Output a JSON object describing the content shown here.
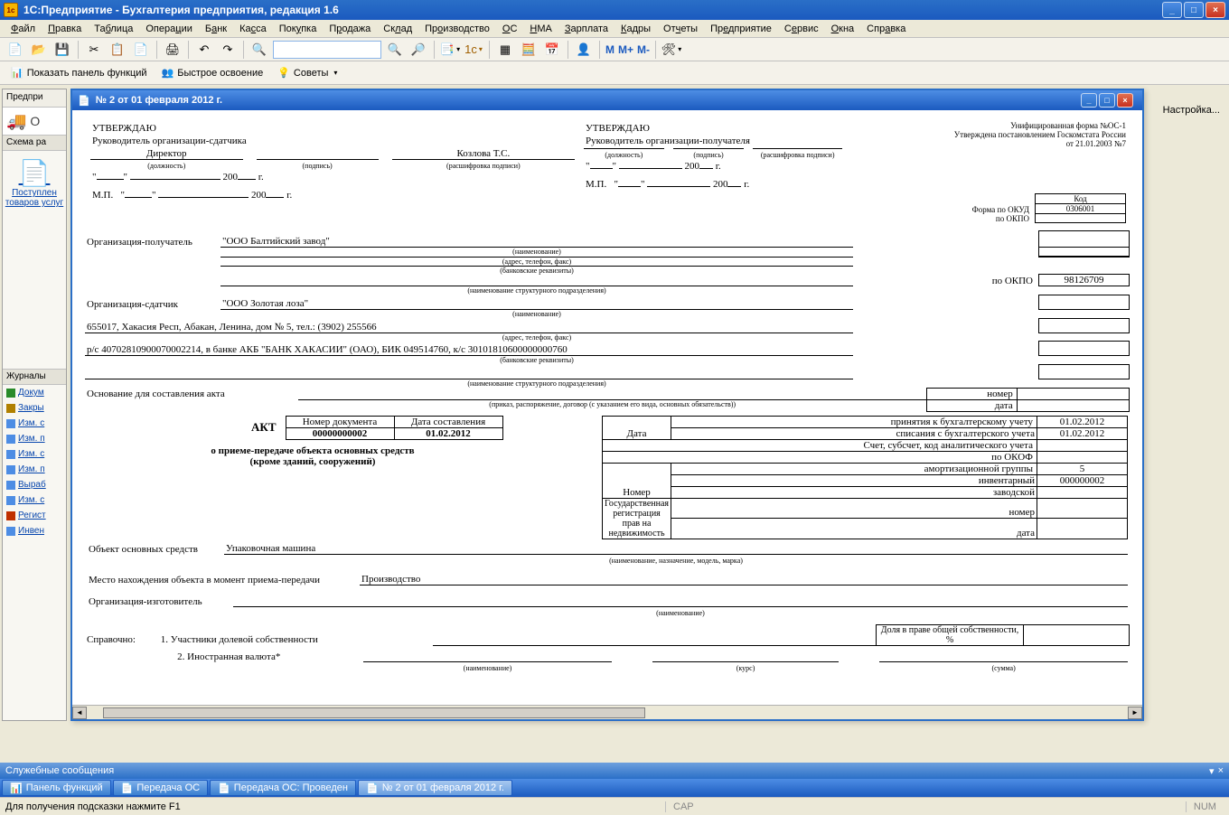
{
  "app_title": "1С:Предприятие  - Бухгалтерия предприятия, редакция 1.6",
  "menu": [
    "Файл",
    "Правка",
    "Таблица",
    "Операции",
    "Банк",
    "Касса",
    "Покупка",
    "Продажа",
    "Склад",
    "Производство",
    "ОС",
    "НМА",
    "Зарплата",
    "Кадры",
    "Отчеты",
    "Предприятие",
    "Сервис",
    "Окна",
    "Справка"
  ],
  "toolbar2": {
    "show_panel": "Показать панель функций",
    "quick_learn": "Быстрое освоение",
    "tips": "Советы"
  },
  "m_buttons": [
    "M",
    "M+",
    "M-"
  ],
  "left": {
    "tab1": "Предпри",
    "bigitem": "Поступлен\nтоваров\nуслуг",
    "hdr_schema": "Схема ра",
    "hdr_journals": "Журналы",
    "items": [
      "Докум",
      "Закры",
      "Изм. с",
      "Изм. п",
      "Изм. с",
      "Изм. п",
      "Выраб",
      "Изм. с",
      "Регист",
      "Инвен"
    ]
  },
  "right_label": "Настройка...",
  "docwin_title": "№ 2 от 01 февраля 2012 г.",
  "doc": {
    "form_header1": "Унифицированная форма №ОС-1",
    "form_header2": "Утверждена постановлением Госкомстата России",
    "form_header3": "от 21.01.2003 №7",
    "approve": "УТВЕРЖДАЮ",
    "head_sender": "Руководитель организации-сдатчика",
    "head_receiver": "Руководитель организации-получателя",
    "director": "Директор",
    "signer": "Козлова Т.С.",
    "position_caption": "(должность)",
    "sign_caption": "(подпись)",
    "decode_caption": "(расшифровка подписи)",
    "year200": "200",
    "year_g": "г.",
    "mp": "М.П.",
    "code_label": "Код",
    "okud_label": "Форма по ОКУД",
    "okud_code": "0306001",
    "okpo_label": "по ОКПО",
    "org_receiver_label": "Организация-получатель",
    "org_receiver_value": "\"ООО Балтийский завод\"",
    "name_caption": "(наименование)",
    "addr_caption": "(адрес, телефон, факс)",
    "bank_caption": "(банковские реквизиты)",
    "struct_caption": "(наименование структурного подразделения)",
    "okpo2_code": "98126709",
    "org_sender_label": "Организация-сдатчик",
    "org_sender_value": "\"ООО Золотая лоза\"",
    "sender_addr": "655017, Хакасия Респ, Абакан, Ленина, дом № 5, тел.: (3902) 255566",
    "sender_bank": "р/с 40702810900070002214, в банке АКБ \"БАНК ХАКАСИИ\" (ОАО), БИК 049514760, к/с 30101810600000000760",
    "basis_label": "Основание для составления акта",
    "basis_caption": "(приказ, распоряжение, договор (с указанием его вида, основных обязательств))",
    "number_label": "номер",
    "date_label": "дата",
    "data_caption": "Дата",
    "accept_accounting": "принятия к бухгалтерскому учету",
    "writeoff_accounting": "списания с бухгалтерского учета",
    "date1": "01.02.2012",
    "date2": "01.02.2012",
    "account_code_label": "Счет, субсчет, код аналитического учета",
    "okof_label": "по ОКОФ",
    "amort_group_label": "амортизационной группы",
    "amort_group_value": "5",
    "inventory_label": "инвентарный",
    "inventory_value": "000000002",
    "factory_label": "заводской",
    "state_reg_label": "Государственная регистрация прав на недвижимость",
    "nomer_label": "Номер",
    "akt_title": "АКТ",
    "doc_num_label": "Номер документа",
    "doc_date_label": "Дата составления",
    "doc_num": "00000000002",
    "doc_date": "01.02.2012",
    "akt_line1": "о приеме-передаче объекта основных средств",
    "akt_line2": "(кроме зданий, сооружений)",
    "object_label": "Объект основных средств",
    "object_value": "Упаковочная машина",
    "object_caption": "(наименование, назначение, модель, марка)",
    "location_label": "Место нахождения объекта в момент приема-передачи",
    "location_value": "Производство",
    "manufacturer_label": "Организация-изготовитель",
    "reference_label": "Справочно:",
    "ref1": "1. Участники долевой собственности",
    "share_label": "Доля в праве общей собственности, %",
    "ref2": "2. Иностранная валюта*",
    "ref2_caption": "(наименование)",
    "kvys_caption": "(курс)",
    "summa_caption": "(сумма)"
  },
  "svc_msg_title": "Служебные сообщения",
  "taskbar_items": [
    "Панель функций",
    "Передача ОС",
    "Передача ОС: Проведен",
    "№ 2 от 01 февраля 2012 г."
  ],
  "status_hint": "Для получения подсказки нажмите F1",
  "status_cap": "CAP",
  "status_num": "NUM"
}
